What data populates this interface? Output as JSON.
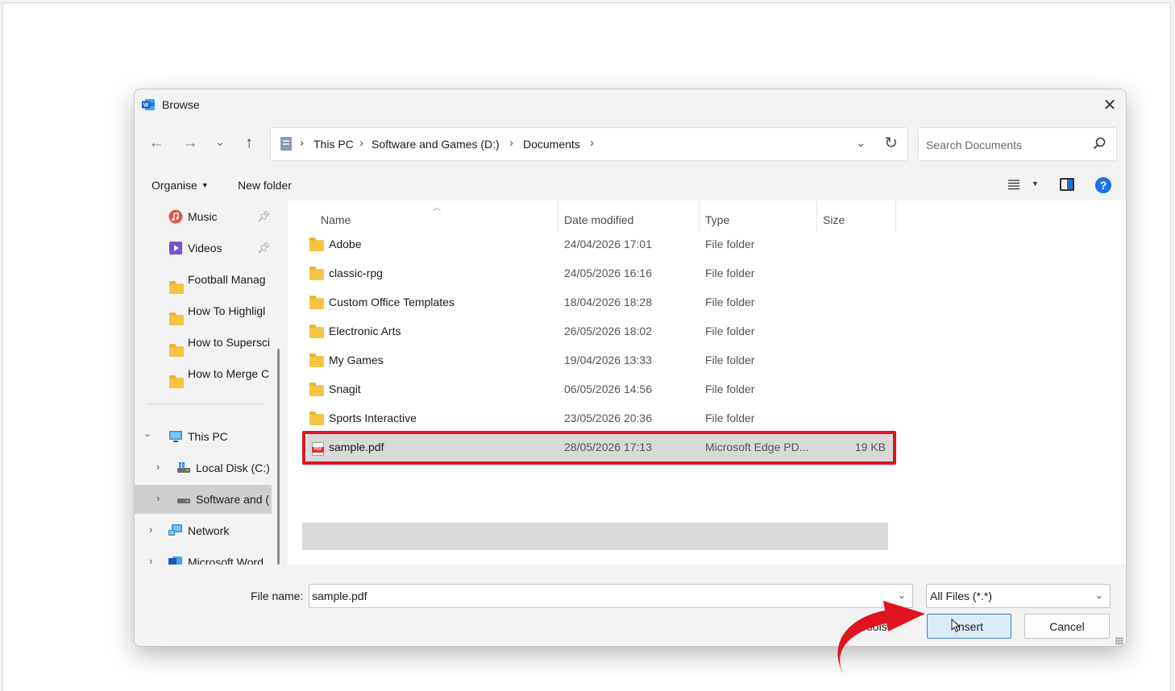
{
  "dialog": {
    "title": "Browse",
    "close_glyph": "✕"
  },
  "nav": {
    "back_glyph": "←",
    "forward_glyph": "→",
    "recent_glyph": "⌄",
    "up_glyph": "↑",
    "breadcrumb": [
      "This PC",
      "Software and Games (D:)",
      "Documents"
    ],
    "refresh_glyph": "↻",
    "search_placeholder": "Search Documents"
  },
  "toolbar": {
    "organise": "Organise",
    "new_folder": "New folder"
  },
  "sidebar": {
    "items": [
      {
        "label": "Music",
        "icon": "music-icon",
        "pinned": true
      },
      {
        "label": "Videos",
        "icon": "videos-icon",
        "pinned": true
      },
      {
        "label": "Football Manag",
        "icon": "folder-icon"
      },
      {
        "label": "How To Highligl",
        "icon": "folder-icon"
      },
      {
        "label": "How to Supersci",
        "icon": "folder-icon"
      },
      {
        "label": "How to Merge C",
        "icon": "folder-icon"
      },
      {
        "label": "This PC",
        "icon": "pc-icon",
        "expanded": true
      },
      {
        "label": "Local Disk (C:)",
        "icon": "drive-icon"
      },
      {
        "label": "Software and (",
        "icon": "drive-icon",
        "selected": true
      },
      {
        "label": "Network",
        "icon": "network-icon"
      },
      {
        "label": "Microsoft Word",
        "icon": "word-icon"
      }
    ]
  },
  "files": {
    "columns": [
      "Name",
      "Date modified",
      "Type",
      "Size"
    ],
    "rows": [
      {
        "name": "Adobe",
        "date": "24/04/2026 17:01",
        "type": "File folder",
        "size": ""
      },
      {
        "name": "classic-rpg",
        "date": "24/05/2026 16:16",
        "type": "File folder",
        "size": ""
      },
      {
        "name": "Custom Office Templates",
        "date": "18/04/2026 18:28",
        "type": "File folder",
        "size": ""
      },
      {
        "name": "Electronic Arts",
        "date": "26/05/2026 18:02",
        "type": "File folder",
        "size": ""
      },
      {
        "name": "My Games",
        "date": "19/04/2026 13:33",
        "type": "File folder",
        "size": ""
      },
      {
        "name": "Snagit",
        "date": "06/05/2026 14:56",
        "type": "File folder",
        "size": ""
      },
      {
        "name": "Sports Interactive",
        "date": "23/05/2026 20:36",
        "type": "File folder",
        "size": ""
      },
      {
        "name": "sample.pdf",
        "date": "28/05/2026 17:13",
        "type": "Microsoft Edge PD...",
        "size": "19 KB",
        "selected": true
      }
    ]
  },
  "bottom": {
    "file_name_label": "File name:",
    "file_name_value": "sample.pdf",
    "file_type_value": "All Files (*.*)",
    "tools_label": "Tools",
    "insert_label": "Insert",
    "cancel_label": "Cancel"
  },
  "colors": {
    "highlight": "#e0141e",
    "accent": "#1a73e8",
    "folder": "#f5c443"
  }
}
